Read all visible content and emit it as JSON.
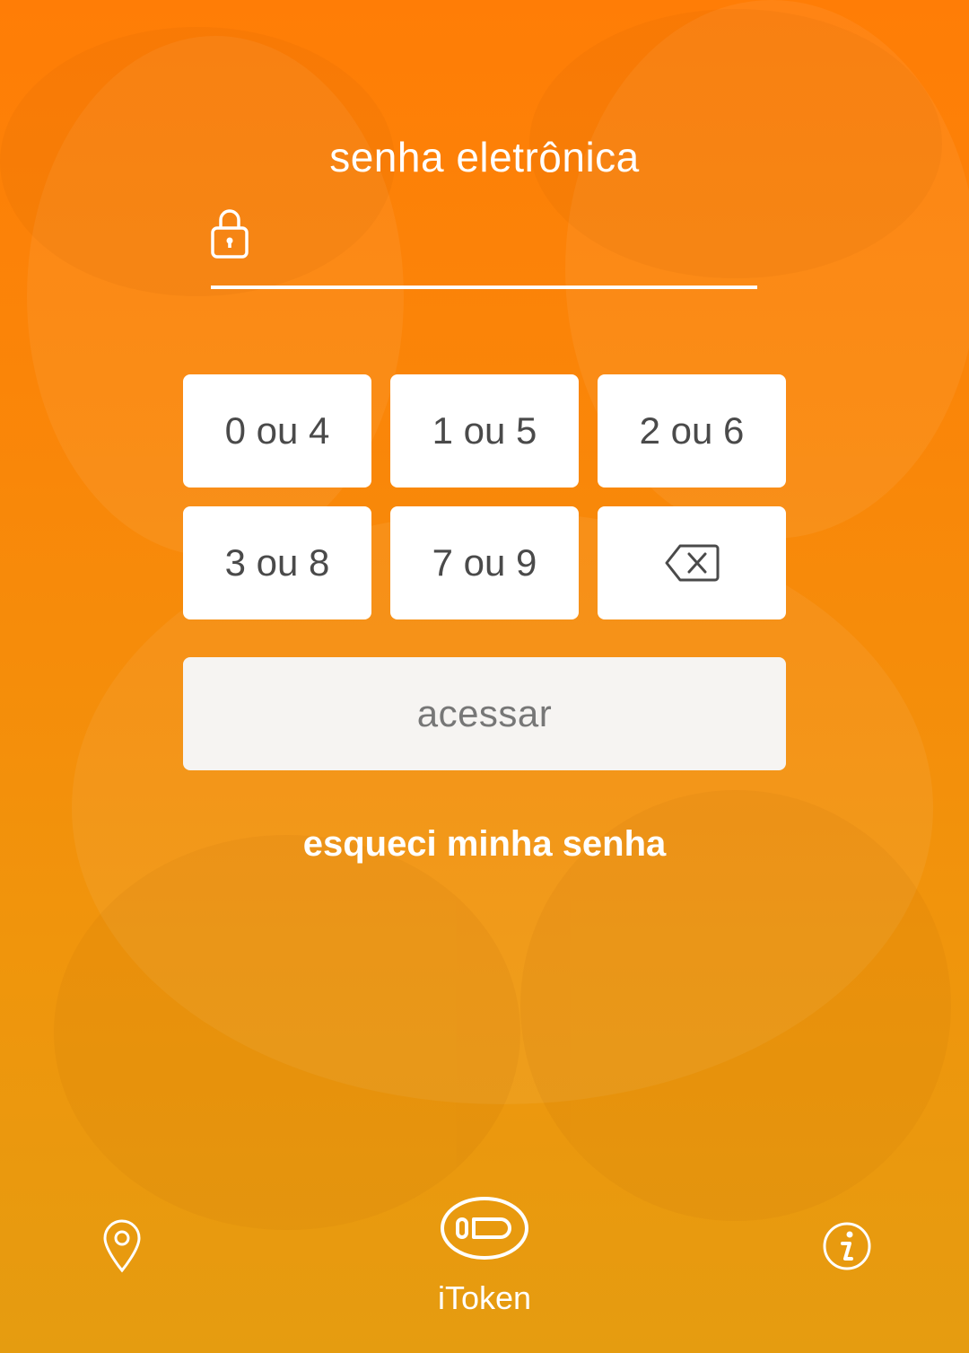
{
  "header": {
    "title": "senha eletrônica"
  },
  "password_field": {
    "icon": "lock-icon",
    "value": ""
  },
  "keypad": {
    "keys": [
      "0 ou 4",
      "1 ou 5",
      "2 ou 6",
      "3 ou 8",
      "7 ou 9"
    ],
    "backspace_icon": "backspace-icon"
  },
  "actions": {
    "access_label": "acessar",
    "forgot_label": "esqueci minha senha"
  },
  "footer": {
    "location_icon": "map-pin-icon",
    "itoken_label": "iToken",
    "itoken_icon": "token-icon",
    "info_icon": "info-icon"
  },
  "colors": {
    "background_top": "#ff7d06",
    "background_bottom": "#e59c10",
    "key_text": "#4a4a4a",
    "access_button_bg": "#f6f4f2",
    "access_button_text": "#777777"
  }
}
